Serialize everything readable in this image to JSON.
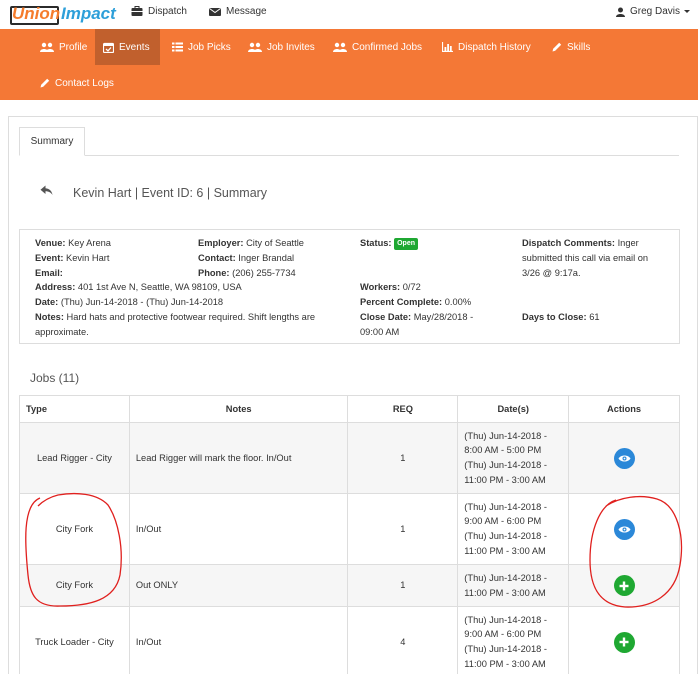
{
  "brand": {
    "union": "Union",
    "impact": "Impact"
  },
  "topnav": {
    "dispatch": "Dispatch",
    "message": "Message",
    "user": "Greg Davis"
  },
  "nav": {
    "profile": "Profile",
    "events": "Events",
    "job_picks": "Job Picks",
    "job_invites": "Job Invites",
    "confirmed_jobs": "Confirmed Jobs",
    "dispatch_history": "Dispatch History",
    "skills": "Skills",
    "contact_logs": "Contact Logs"
  },
  "tab": {
    "summary": "Summary"
  },
  "page_title": "Kevin Hart | Event ID: 6 | Summary",
  "event": {
    "venue_label": "Venue:",
    "venue": "Key Arena",
    "event_label": "Event:",
    "event": "Kevin Hart",
    "email_label": "Email:",
    "email": "",
    "address_label": "Address:",
    "address": "401 1st Ave N, Seattle, WA 98109, USA",
    "date_label": "Date:",
    "date": "(Thu) Jun-14-2018 - (Thu) Jun-14-2018",
    "notes_label": "Notes:",
    "notes_line1": "Hard hats and protective footwear required. Shift lengths are",
    "notes_line2": "approximate.",
    "employer_label": "Employer:",
    "employer": "City of Seattle",
    "contact_label": "Contact:",
    "contact": "Inger Brandal",
    "phone_label": "Phone:",
    "phone": "(206) 255-7734",
    "status_label": "Status:",
    "status": "Open",
    "workers_label": "Workers:",
    "workers": "0/72",
    "percent_label": "Percent Complete:",
    "percent": "0.00%",
    "close_label": "Close Date:",
    "close_line1": "May/28/2018 -",
    "close_line2": "09:00 AM",
    "comments_label": "Dispatch Comments:",
    "comments_line1": "Inger",
    "comments_line2": "submitted this call via email on",
    "comments_line3": "3/26 @ 9:17a.",
    "days_label": "Days to Close:",
    "days": "61"
  },
  "jobs": {
    "heading": "Jobs (11)",
    "columns": {
      "type": "Type",
      "notes": "Notes",
      "req": "REQ",
      "dates": "Date(s)",
      "actions": "Actions"
    },
    "rows": [
      {
        "type": "Lead Rigger - City",
        "notes": "Lead Rigger will mark the floor. In/Out",
        "req": "1",
        "d1": "(Thu) Jun-14-2018 -",
        "d2": "8:00 AM - 5:00 PM",
        "d3": "(Thu) Jun-14-2018 -",
        "d4": "11:00 PM - 3:00 AM",
        "action": "view-icon"
      },
      {
        "type": "City Fork",
        "notes": "In/Out",
        "req": "1",
        "d1": "(Thu) Jun-14-2018 -",
        "d2": "9:00 AM - 6:00 PM",
        "d3": "(Thu) Jun-14-2018 -",
        "d4": "11:00 PM - 3:00 AM",
        "action": "view-icon"
      },
      {
        "type": "City Fork",
        "notes": "Out ONLY",
        "req": "1",
        "d1": "(Thu) Jun-14-2018 -",
        "d2": "11:00 PM - 3:00 AM",
        "action": "add-icon"
      },
      {
        "type": "Truck Loader - City",
        "notes": "In/Out",
        "req": "4",
        "d1": "(Thu) Jun-14-2018 -",
        "d2": "9:00 AM - 6:00 PM",
        "d3": "(Thu) Jun-14-2018 -",
        "d4": "11:00 PM - 3:00 AM",
        "action": "add-icon"
      }
    ]
  },
  "colors": {
    "nav_orange": "#f47836",
    "nav_active": "#c1602d",
    "view_blue": "#2b88d8",
    "add_green": "#1fa832",
    "status_green": "#1fa832",
    "annotation_red": "#e0201e"
  }
}
